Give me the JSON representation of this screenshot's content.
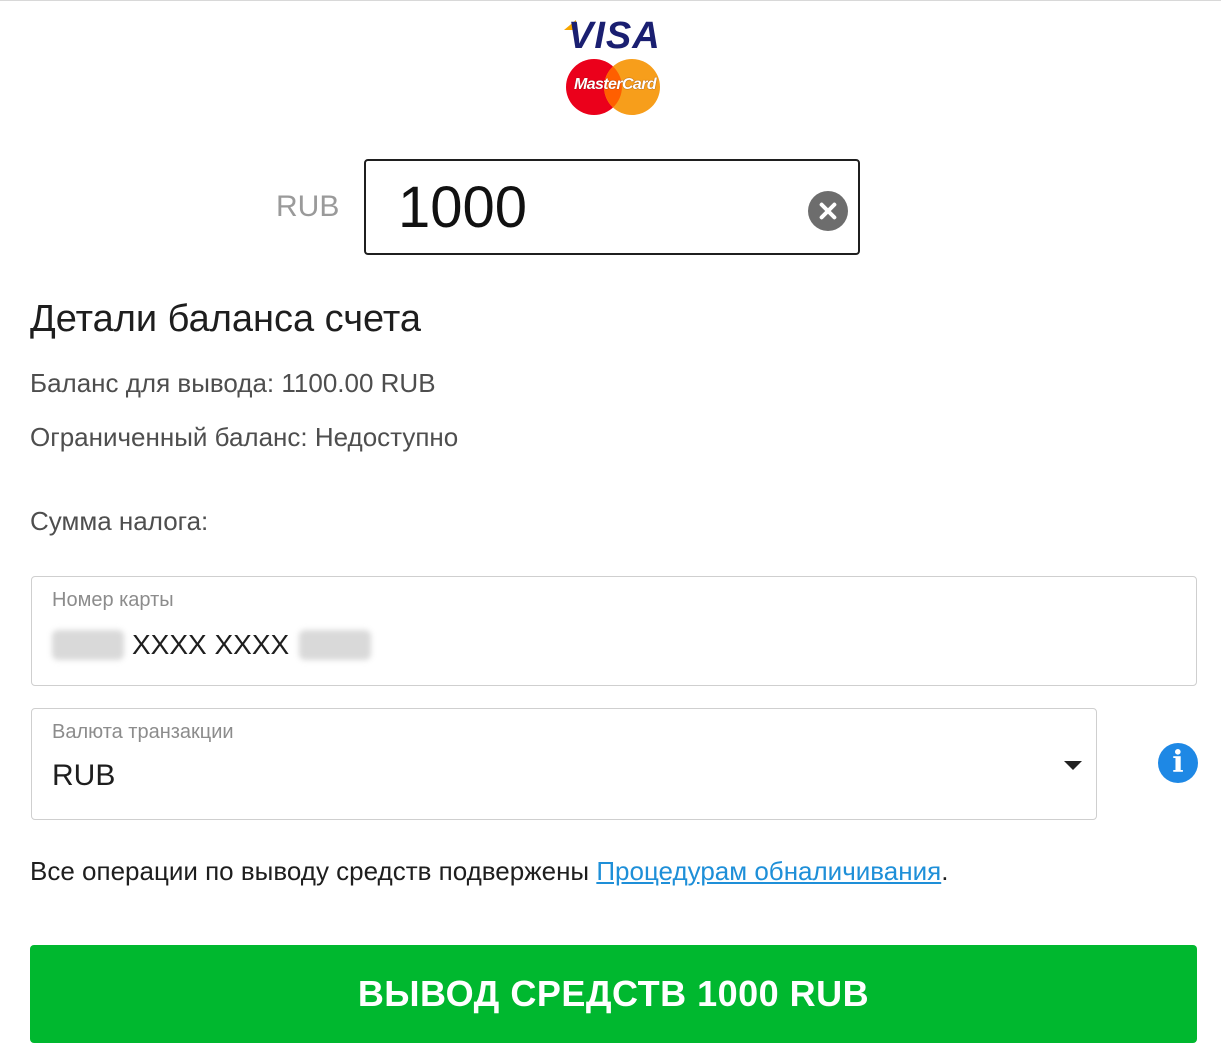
{
  "logos": {
    "visa": "VISA",
    "mastercard": "MasterCard"
  },
  "amount": {
    "currency_label": "RUB",
    "value": "1000"
  },
  "details": {
    "title": "Детали баланса счета",
    "withdraw_balance": "Баланс для вывода: 1100.00 RUB",
    "restricted_balance": "Ограниченный баланс: Недоступно",
    "tax_amount": "Сумма налога:"
  },
  "card_field": {
    "label": "Номер карты",
    "masked_middle": "XXXX XXXX"
  },
  "currency_field": {
    "label": "Валюта транзакции",
    "selected": "RUB"
  },
  "notice": {
    "text": "Все операции по выводу средств подвержены ",
    "link": "Процедурам обналичивания",
    "suffix": "."
  },
  "submit": {
    "label": "ВЫВОД СРЕДСТВ 1000 RUB"
  },
  "colors": {
    "button": "#00b82f",
    "link": "#1e8fd8",
    "info_icon": "#1e88e5",
    "visa": "#1a1f71",
    "mastercard_red": "#eb001b",
    "mastercard_orange": "#f79e1b"
  },
  "icons": {
    "clear": "close-circle-icon",
    "dropdown": "caret-down-icon",
    "info": "info-circle-icon"
  }
}
